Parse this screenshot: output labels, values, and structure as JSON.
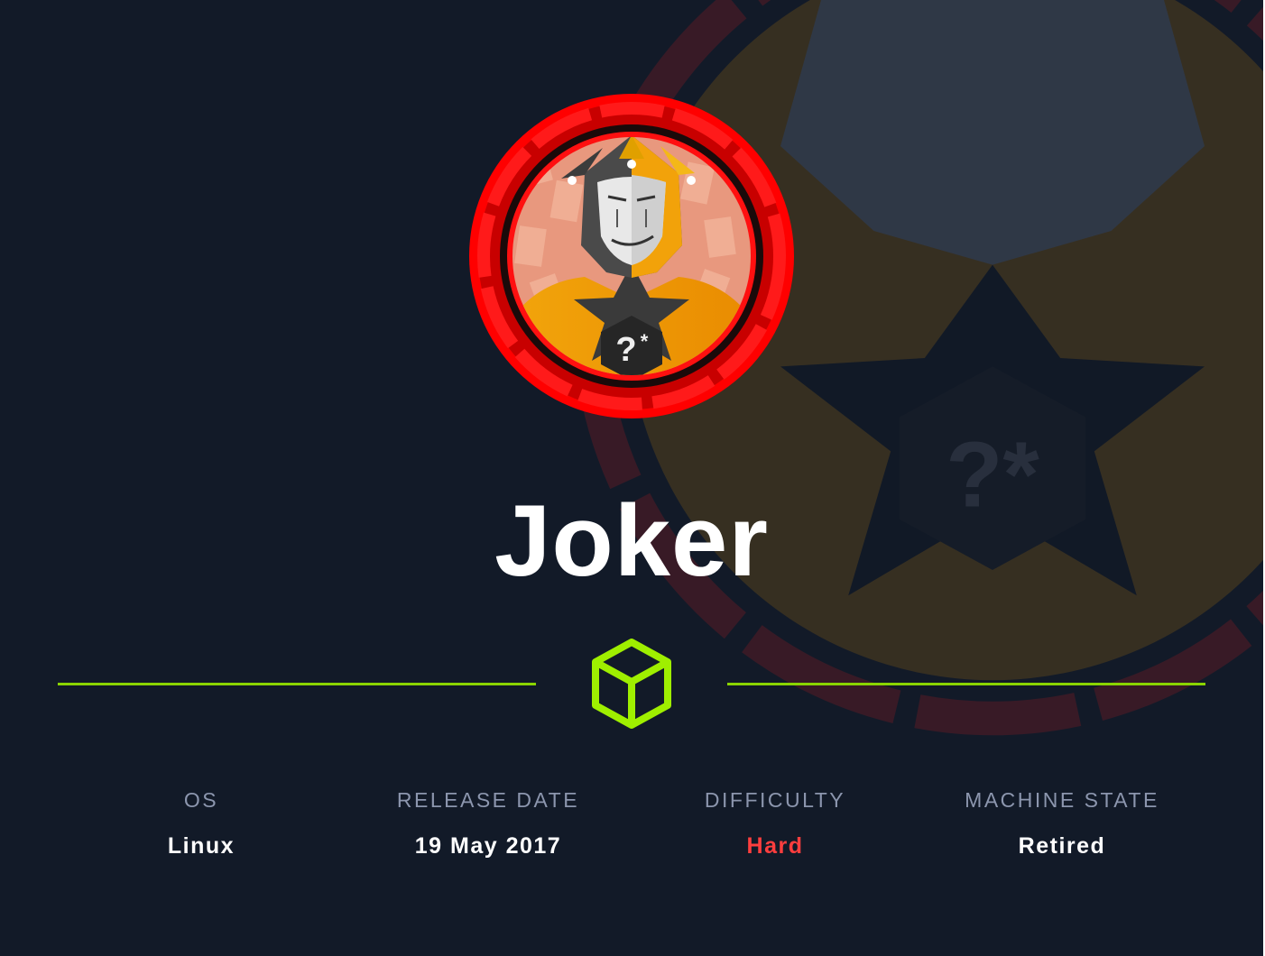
{
  "machine": {
    "name": "Joker",
    "avatar_icon": "joker-jester-avatar",
    "badge_icon": "question-asterisk-hexagon-icon",
    "divider_icon": "cube-icon"
  },
  "stats": [
    {
      "label": "OS",
      "value": "Linux"
    },
    {
      "label": "RELEASE DATE",
      "value": "19 May 2017"
    },
    {
      "label": "DIFFICULTY",
      "value": "Hard"
    },
    {
      "label": "MACHINE STATE",
      "value": "Retired"
    }
  ],
  "colors": {
    "background": "#121a28",
    "accent_line": "#8ad400",
    "difficulty_hard": "#ff3e3e",
    "ring_red": "#ff0000",
    "label_grey": "#8c96ae"
  }
}
